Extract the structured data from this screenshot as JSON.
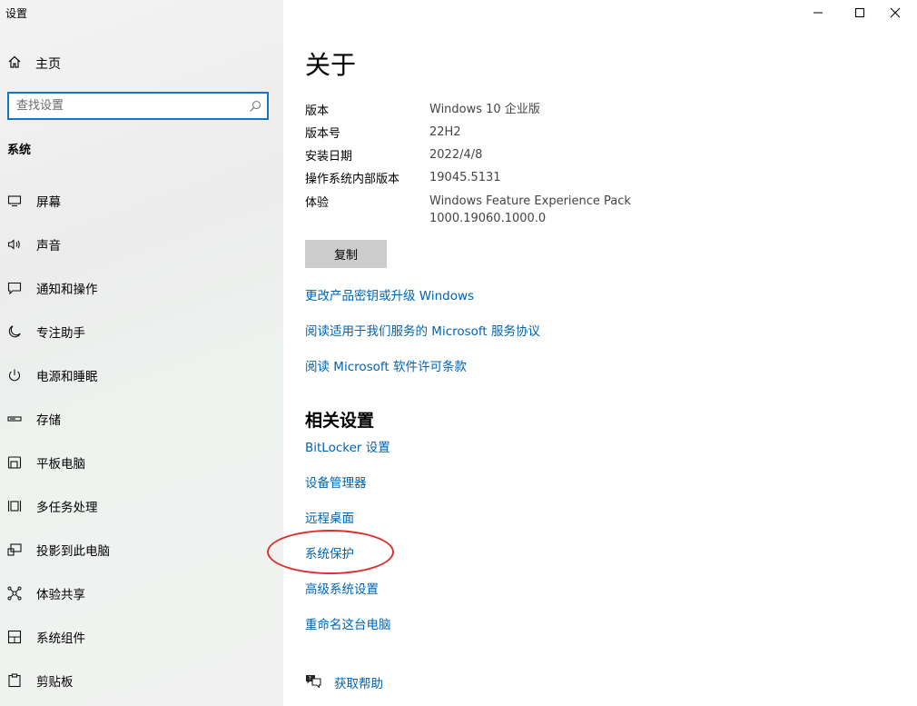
{
  "window": {
    "title": "设置"
  },
  "sidebar": {
    "home_label": "主页",
    "search_placeholder": "查找设置",
    "section_title": "系统",
    "items": [
      {
        "label": "屏幕",
        "icon": "monitor-icon"
      },
      {
        "label": "声音",
        "icon": "speaker-icon"
      },
      {
        "label": "通知和操作",
        "icon": "notification-icon"
      },
      {
        "label": "专注助手",
        "icon": "moon-icon"
      },
      {
        "label": "电源和睡眠",
        "icon": "power-icon"
      },
      {
        "label": "存储",
        "icon": "storage-icon"
      },
      {
        "label": "平板电脑",
        "icon": "tablet-icon"
      },
      {
        "label": "多任务处理",
        "icon": "multitask-icon"
      },
      {
        "label": "投影到此电脑",
        "icon": "project-icon"
      },
      {
        "label": "体验共享",
        "icon": "share-icon"
      },
      {
        "label": "系统组件",
        "icon": "components-icon"
      },
      {
        "label": "剪贴板",
        "icon": "clipboard-icon"
      }
    ]
  },
  "main": {
    "title": "关于",
    "specs": [
      {
        "key": "版本",
        "value": "Windows 10 企业版"
      },
      {
        "key": "版本号",
        "value": "22H2"
      },
      {
        "key": "安装日期",
        "value": "2022/4/8"
      },
      {
        "key": "操作系统内部版本",
        "value": "19045.5131"
      },
      {
        "key": "体验",
        "value": "Windows Feature Experience Pack 1000.19060.1000.0"
      }
    ],
    "copy_label": "复制",
    "links": [
      "更改产品密钥或升级 Windows",
      "阅读适用于我们服务的 Microsoft 服务协议",
      "阅读 Microsoft 软件许可条款"
    ],
    "related_title": "相关设置",
    "related_links": [
      "BitLocker 设置",
      "设备管理器",
      "远程桌面",
      "系统保护",
      "高级系统设置",
      "重命名这台电脑"
    ],
    "help_label": "获取帮助"
  },
  "colors": {
    "accent": "#0063b1",
    "annotation": "#d9302e",
    "search_border": "#1a73c7"
  }
}
